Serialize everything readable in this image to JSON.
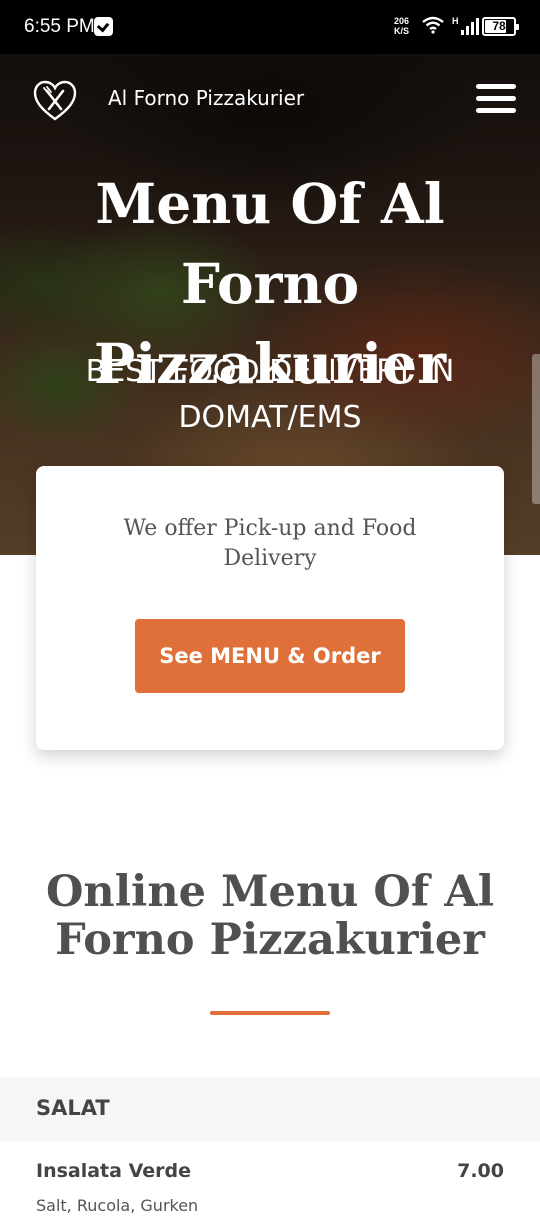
{
  "status_bar": {
    "time": "6:55 PM",
    "speed_value": "206",
    "speed_unit": "K/S",
    "network_type": "H",
    "battery_level": "78",
    "icons": [
      "vpn-key-icon",
      "wifi-icon",
      "signal-icon",
      "battery-icon"
    ]
  },
  "nav": {
    "brand": "Al Forno Pizzakurier",
    "logo_icon": "fork-knife-heart-icon",
    "menu_icon": "hamburger-menu-icon"
  },
  "hero": {
    "title": "Menu Of Al Forno Pizzakurier",
    "subtitle": "BEST FOOD DELIVERY IN DOMAT/EMS"
  },
  "card": {
    "text": "We offer Pick-up and Food Delivery",
    "button_label": "See MENU & Order"
  },
  "menu_section": {
    "title": "Online Menu Of Al Forno Pizzakurier",
    "categories": [
      {
        "name": "SALAT",
        "items": [
          {
            "name": "Insalata Verde",
            "price": "7.00",
            "description": "Salt, Rucola, Gurken"
          }
        ]
      }
    ]
  },
  "colors": {
    "accent": "#e0703a",
    "status_bar": "#000000",
    "category_bg": "#f6f6f6",
    "text_dark": "#444444"
  }
}
